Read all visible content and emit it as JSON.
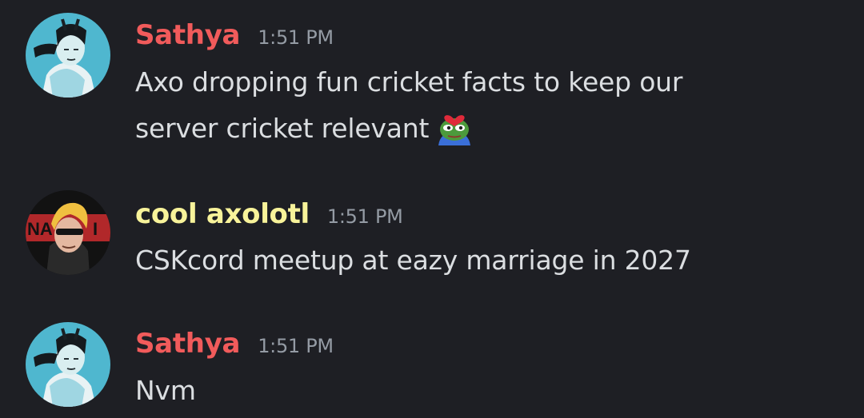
{
  "colors": {
    "background": "#1e1f24",
    "name_sathya": "#f15b5b",
    "name_axolotl": "#f8f39a",
    "timestamp": "#949ba4",
    "message_text": "#dbdee1"
  },
  "messages": [
    {
      "author": "Sathya",
      "timestamp": "1:51 PM",
      "line1": "Axo dropping fun cricket facts to keep our",
      "line2": "server cricket relevant",
      "emoji": "pepe-heart-emoji"
    },
    {
      "author": "cool axolotl",
      "timestamp": "1:51 PM",
      "text": "CSKcord meetup at eazy marriage in 2027"
    },
    {
      "author": "Sathya",
      "timestamp": "1:51 PM",
      "text": "Nvm"
    }
  ]
}
